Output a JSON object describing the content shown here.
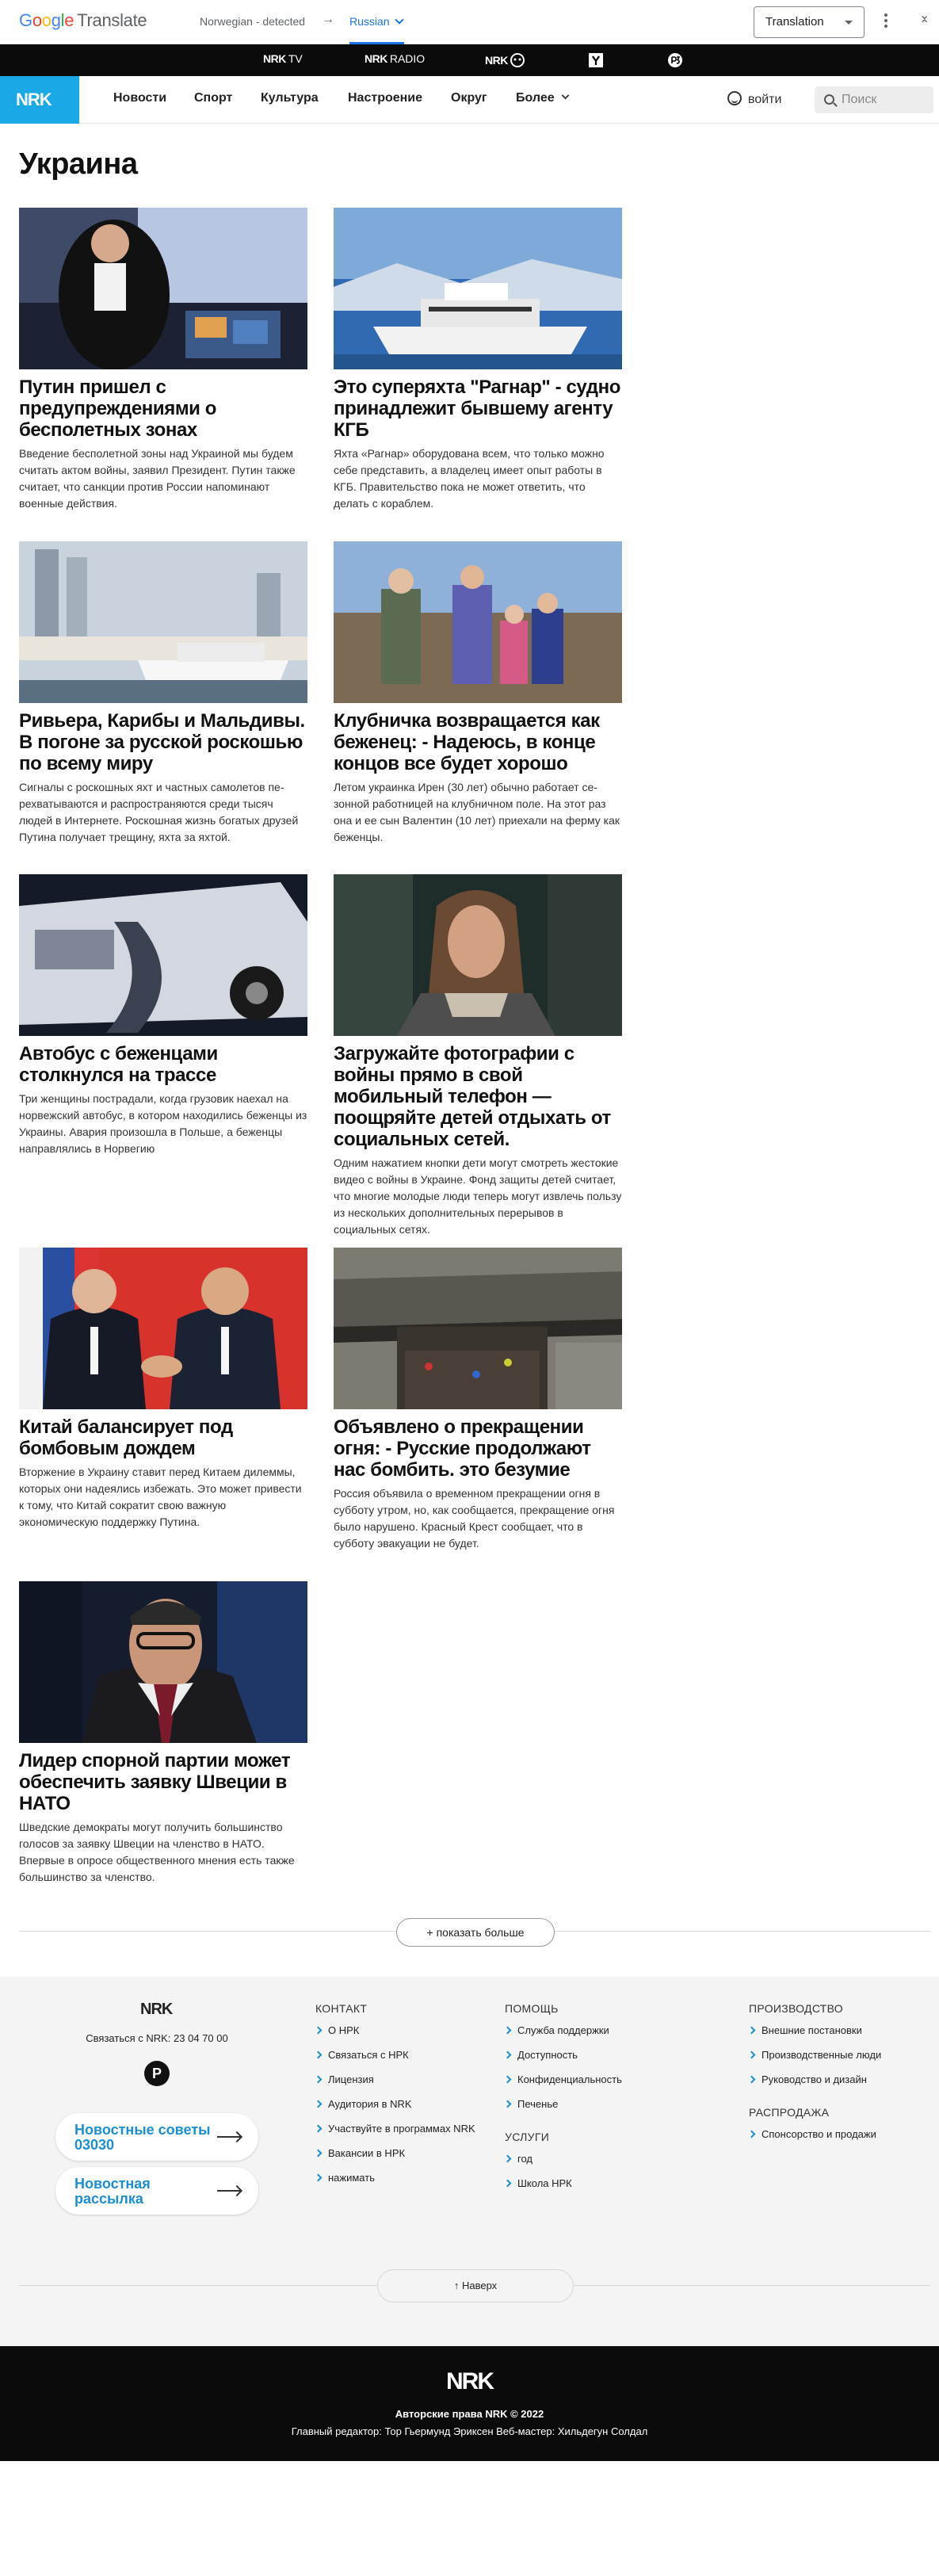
{
  "translate_bar": {
    "logo_google_letters": [
      "G",
      "o",
      "o",
      "g",
      "l",
      "e"
    ],
    "logo_word": "Translate",
    "source_language": "Norwegian - detected",
    "arrow": "→",
    "target_language": "Russian",
    "mode_select": "Translation",
    "colors": {
      "blue": "#4285f4",
      "red": "#ea4335",
      "yellow": "#fbbc05",
      "green": "#34a853",
      "accent": "#1a73e8"
    }
  },
  "nrk_strip": {
    "tv_logo": "NRK",
    "tv_label": "TV",
    "radio_logo": "NRK",
    "radio_label": "RADIO",
    "super_logo": "NRK",
    "icons": [
      "nrk-super-icon",
      "yr-icon",
      "p3-icon"
    ]
  },
  "nav": {
    "logo": "NRK",
    "brand_color": "#1aa8e6",
    "items": [
      "Новости",
      "Спорт",
      "Культура",
      "Настроение",
      "Округ",
      "Более"
    ],
    "login": "войти",
    "search_placeholder": "Поиск"
  },
  "page": {
    "title": "Украина"
  },
  "articles": [
    {
      "title": "Путин пришел с предупреждениями о бесполетных зонах",
      "summary": "Введение бесполетной зоны над Украиной мы бу­дем считать актом войны, заявил Президент. Путин также считает, что санкции против России напоми­нают военные действия."
    },
    {
      "title": "Это суперяхта \"Рагнар\" - судно принадлежит бывшему агенту КГБ",
      "summary": "Яхта «Рагнар» оборудована всем, что только мож­но себе представить, а владелец имеет опыт рабо­ты в КГБ. Правительство пока не может ответить, что делать с кораблем."
    },
    {
      "title": "Ривьера, Карибы и Мальдивы. В погоне за русской роскошью по всему миру",
      "summary": "Сигналы с роскошных яхт и частных самолетов пе­рехватываются и распространяются среди тысяч людей в Интернете. Роскошная жизнь богатых дру­зей Путина получает трещину, яхта за яхтой."
    },
    {
      "title": "Клубничка возвращается как беженец: - Надеюсь, в конце концов все будет хорошо",
      "summary": "Летом украинка Ирен (30 лет) обычно работает се­зонной работницей на клубничном поле. На этот раз она и ее сын Валентин (10 лет) приехали на ферму как беженцы."
    },
    {
      "title": "Автобус с беженцами столкнулся на трассе",
      "summary": "Три женщины пострадали, когда грузовик наехал на норвежский автобус, в котором находились бе­женцы из Украины. Авария произошла в Польше, а беженцы направлялись в Норвегию"
    },
    {
      "title": "Загружайте фотографии с войны прямо в свой мобильный телефон — поощряйте детей отдыхать от социальных сетей.",
      "summary": "Одним нажатием кнопки дети могут смотреть же­стокие видео с войны в Украине. Фонд защиты де­тей считает, что многие молодые люди теперь мо­гут извлечь пользу из нескольких дополнительных перерывов в социальных сетях."
    },
    {
      "title": "Китай балансирует под бомбовым дождем",
      "summary": "Вторжение в Украину ставит перед Китаем дилем­мы, которых они надеялись избежать. Это может привести к тому, что Китай сократит свою важную экономическую поддержку Путина."
    },
    {
      "title": "Объявлено о прекращении огня: - Русские продолжают нас бомбить. это безумие",
      "summary": "Россия объявила о временном прекращении огня в субботу утром, но, как сообщается, прекращение огня было нарушено. Красный Крест сообщает, что в субботу эвакуации не будет."
    },
    {
      "title": "Лидер спорной партии может обеспечить заявку Швеции в НАТО",
      "summary": "Шведские демократы могут получить большинство голосов за заявку Швеции на членство в НАТО. Впервые в опросе общественного мнения есть так­же большинство за членство."
    }
  ],
  "show_more": "+ показать больше",
  "footer": {
    "logo": "NRK",
    "phone": "Связаться с NRK: 23 04 70 00",
    "podcast_letter": "P",
    "tips": "Новостные советы 03030",
    "newsletter": "Новостная рассылка",
    "contact": {
      "heading": "Контакт",
      "links": [
        "О НРК",
        "Связаться с НРК",
        "Лицензия",
        "Аудитория в NRK",
        "Участвуйте в программах NRK",
        "Вакансии в НРК",
        "нажимать"
      ]
    },
    "help": {
      "heading": "Помощь",
      "links": [
        "Служба поддержки",
        "Доступность",
        "Конфиденциальность",
        "Печенье"
      ]
    },
    "services": {
      "heading": "Услуги",
      "links": [
        "год",
        "Школа НРК"
      ]
    },
    "production": {
      "heading": "Производство",
      "links": [
        "Внешние постановки",
        "Производственные люди",
        "Руководство и дизайн"
      ]
    },
    "sales": {
      "heading": "Распродажа",
      "links": [
        "Спонсорство и продажи"
      ]
    },
    "to_top": "↑ Наверх"
  },
  "bottom": {
    "logo": "NRK",
    "copyright": "Авторские права NRK © 2022",
    "editors": "Главный редактор: Тор Гьермунд Эриксен   Веб-мастер: Хильдегун Солдал"
  }
}
